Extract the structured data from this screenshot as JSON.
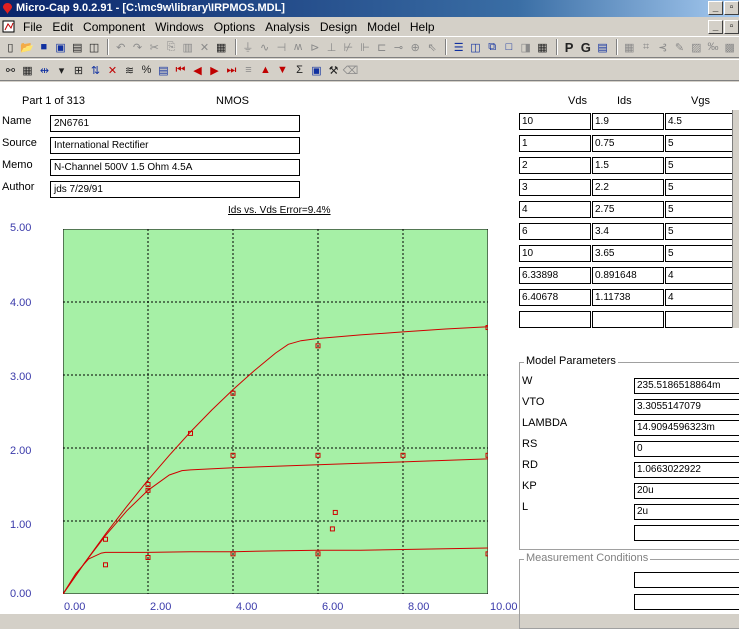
{
  "window": {
    "title": "Micro-Cap 9.0.2.91 - [C:\\mc9w\\library\\IRPMOS.MDL]"
  },
  "menu": [
    "File",
    "Edit",
    "Component",
    "Windows",
    "Options",
    "Analysis",
    "Design",
    "Model",
    "Help"
  ],
  "toolbar1": [
    {
      "name": "new-file-icon",
      "glyph": "▯",
      "tone": ""
    },
    {
      "name": "open-file-icon",
      "glyph": "📂",
      "tone": ""
    },
    {
      "name": "save-icon",
      "glyph": "■",
      "tone": "blue"
    },
    {
      "name": "save-all-icon",
      "glyph": "▣",
      "tone": "blue"
    },
    {
      "name": "print-icon",
      "glyph": "▤",
      "tone": ""
    },
    {
      "name": "print-preview-icon",
      "glyph": "◫",
      "tone": ""
    },
    {
      "sep": true
    },
    {
      "name": "undo-icon",
      "glyph": "↶",
      "tone": "gray"
    },
    {
      "name": "redo-icon",
      "glyph": "↷",
      "tone": "gray"
    },
    {
      "name": "cut-icon",
      "glyph": "✂",
      "tone": "gray"
    },
    {
      "name": "copy-icon",
      "glyph": "⎘",
      "tone": "gray"
    },
    {
      "name": "paste-icon",
      "glyph": "▥",
      "tone": "gray"
    },
    {
      "name": "delete-icon",
      "glyph": "✕",
      "tone": "gray"
    },
    {
      "name": "find-icon",
      "glyph": "▦",
      "tone": ""
    },
    {
      "sep": true
    },
    {
      "name": "ground-icon",
      "glyph": "⏚",
      "tone": "gray"
    },
    {
      "name": "resistor-icon",
      "glyph": "∿",
      "tone": "gray"
    },
    {
      "name": "capacitor-icon",
      "glyph": "⊣",
      "tone": "gray"
    },
    {
      "name": "inductor-icon",
      "glyph": "ʍ",
      "tone": "gray"
    },
    {
      "name": "diode-icon",
      "glyph": "⊳",
      "tone": "gray"
    },
    {
      "name": "battery-icon",
      "glyph": "⊥",
      "tone": "gray"
    },
    {
      "name": "npn-icon",
      "glyph": "⊬",
      "tone": "gray"
    },
    {
      "name": "pmos-icon",
      "glyph": "⊩",
      "tone": "gray"
    },
    {
      "name": "opamp-icon",
      "glyph": "⊏",
      "tone": "gray"
    },
    {
      "name": "wire-icon",
      "glyph": "⊸",
      "tone": "gray"
    },
    {
      "name": "source-icon",
      "glyph": "⊕",
      "tone": "gray"
    },
    {
      "name": "pointer-icon",
      "glyph": "⇖",
      "tone": "gray"
    },
    {
      "sep": true
    },
    {
      "name": "horizontal-layout-icon",
      "glyph": "☰",
      "tone": "blue"
    },
    {
      "name": "vertical-layout-icon",
      "glyph": "◫",
      "tone": "blue"
    },
    {
      "name": "cascade-icon",
      "glyph": "⧉",
      "tone": "blue"
    },
    {
      "name": "maximize-pane-icon",
      "glyph": "□",
      "tone": "blue"
    },
    {
      "name": "split-pane-icon",
      "glyph": "◨",
      "tone": "gray"
    },
    {
      "name": "calculator-icon",
      "glyph": "▦",
      "tone": ""
    },
    {
      "sep": true
    },
    {
      "name": "p-button-icon",
      "glyph": "P",
      "tone": "bold"
    },
    {
      "name": "g-button-icon",
      "glyph": "G",
      "tone": "bold"
    },
    {
      "name": "table-icon",
      "glyph": "▤",
      "tone": "blue"
    },
    {
      "sep": true
    },
    {
      "name": "grid-icon",
      "glyph": "▦",
      "tone": "gray"
    },
    {
      "name": "optimize-icon",
      "glyph": "⌗",
      "tone": "gray"
    },
    {
      "name": "fit-icon",
      "glyph": "⊰",
      "tone": "gray"
    },
    {
      "name": "pen-icon",
      "glyph": "✎",
      "tone": "gray"
    },
    {
      "name": "graph-icon",
      "glyph": "▨",
      "tone": "gray"
    },
    {
      "name": "units-icon",
      "glyph": "‰",
      "tone": "gray"
    },
    {
      "name": "chart-icon",
      "glyph": "▩",
      "tone": "gray"
    }
  ],
  "toolbar2": [
    {
      "name": "binoculars-icon",
      "glyph": "⚯",
      "tone": ""
    },
    {
      "name": "library-icon",
      "glyph": "▦",
      "tone": ""
    },
    {
      "name": "arrow-both-icon",
      "glyph": "⇹",
      "tone": "blue"
    },
    {
      "name": "dropdown-icon",
      "glyph": "▾",
      "tone": ""
    },
    {
      "name": "merge-icon",
      "glyph": "⊞",
      "tone": ""
    },
    {
      "name": "sort-az-icon",
      "glyph": "⇅",
      "tone": "blue"
    },
    {
      "name": "delete-part-icon",
      "glyph": "✕",
      "tone": "red"
    },
    {
      "name": "wave-icon",
      "glyph": "≋",
      "tone": ""
    },
    {
      "name": "percent-icon",
      "glyph": "%",
      "tone": ""
    },
    {
      "name": "list-icon",
      "glyph": "▤",
      "tone": "blue"
    },
    {
      "name": "first-record-icon",
      "glyph": "⏮",
      "tone": "red"
    },
    {
      "name": "previous-record-icon",
      "glyph": "◀",
      "tone": "red"
    },
    {
      "name": "next-record-icon",
      "glyph": "▶",
      "tone": "red"
    },
    {
      "name": "last-record-icon",
      "glyph": "⏭",
      "tone": "red"
    },
    {
      "name": "equal-icon",
      "glyph": "≡",
      "tone": "gray"
    },
    {
      "name": "up-icon",
      "glyph": "▲",
      "tone": "red"
    },
    {
      "name": "down-icon",
      "glyph": "▼",
      "tone": "red"
    },
    {
      "name": "sum-icon",
      "glyph": "Σ",
      "tone": ""
    },
    {
      "name": "monitor-icon",
      "glyph": "▣",
      "tone": "blue"
    },
    {
      "name": "tools-icon",
      "glyph": "⚒",
      "tone": ""
    },
    {
      "name": "eraser-icon",
      "glyph": "⌫",
      "tone": "gray"
    }
  ],
  "part": {
    "counter": "Part 1 of 313",
    "type": "NMOS"
  },
  "fields": [
    {
      "label": "Name",
      "value": "2N6761"
    },
    {
      "label": "Source",
      "value": "International Rectifier"
    },
    {
      "label": "Memo",
      "value": "N-Channel 500V 1.5 Ohm 4.5A"
    },
    {
      "label": "Author",
      "value": "jds 7/29/91"
    }
  ],
  "plot_title": "Ids vs. Vds Error=9.4%",
  "table": {
    "headers": [
      "Vds",
      "Ids",
      "Vgs"
    ],
    "rows": [
      [
        "10",
        "1.9",
        "4.5"
      ],
      [
        "1",
        "0.75",
        "5"
      ],
      [
        "2",
        "1.5",
        "5"
      ],
      [
        "3",
        "2.2",
        "5"
      ],
      [
        "4",
        "2.75",
        "5"
      ],
      [
        "6",
        "3.4",
        "5"
      ],
      [
        "10",
        "3.65",
        "5"
      ],
      [
        "6.33898",
        "0.891648",
        "4"
      ],
      [
        "6.40678",
        "1.11738",
        "4"
      ],
      [
        "",
        "",
        ""
      ]
    ]
  },
  "model_parameters": {
    "title": "Model Parameters",
    "items": [
      {
        "name": "W",
        "value": "235.5186518864m"
      },
      {
        "name": "VTO",
        "value": "3.3055147079"
      },
      {
        "name": "LAMBDA",
        "value": "14.9094596323m"
      },
      {
        "name": "RS",
        "value": "0"
      },
      {
        "name": "RD",
        "value": "1.0663022922"
      },
      {
        "name": "KP",
        "value": "20u"
      },
      {
        "name": "L",
        "value": "2u"
      },
      {
        "name": "",
        "value": ""
      }
    ]
  },
  "measurement_conditions": {
    "title": "Measurement Conditions"
  },
  "chart_data": {
    "type": "scatter",
    "title": "Ids vs. Vds Error=9.4%",
    "xlim": [
      0,
      10
    ],
    "ylim": [
      0,
      5
    ],
    "xticks": [
      "0.00",
      "2.00",
      "4.00",
      "6.00",
      "8.00",
      "10.00"
    ],
    "yticks": [
      "0.00",
      "1.00",
      "2.00",
      "3.00",
      "4.00",
      "5.00"
    ],
    "grid": true,
    "background": "#a6f0a6",
    "curve_color": "#d00000",
    "curves": [
      {
        "x": [
          0,
          0.5,
          1,
          1.5,
          2,
          2.5,
          3,
          3.5,
          4,
          4.5,
          5,
          5.3,
          5.6,
          6,
          7,
          8,
          9,
          10
        ],
        "y": [
          0,
          0.42,
          0.82,
          1.2,
          1.56,
          1.9,
          2.22,
          2.52,
          2.8,
          3.06,
          3.3,
          3.42,
          3.47,
          3.5,
          3.55,
          3.59,
          3.63,
          3.66
        ]
      },
      {
        "x": [
          0,
          0.5,
          1,
          1.5,
          2,
          2.5,
          2.8,
          3,
          4,
          5,
          6,
          7,
          8,
          9,
          10
        ],
        "y": [
          0,
          0.42,
          0.8,
          1.14,
          1.42,
          1.63,
          1.69,
          1.7,
          1.73,
          1.75,
          1.77,
          1.79,
          1.81,
          1.83,
          1.85
        ]
      },
      {
        "x": [
          0,
          0.3,
          0.6,
          0.9,
          1,
          2,
          3,
          4,
          5,
          6,
          7,
          8,
          9,
          10
        ],
        "y": [
          0,
          0.28,
          0.48,
          0.56,
          0.57,
          0.57,
          0.58,
          0.58,
          0.59,
          0.6,
          0.6,
          0.61,
          0.62,
          0.63
        ]
      }
    ],
    "points": [
      {
        "x": 1,
        "y": 0.75
      },
      {
        "x": 2,
        "y": 1.5
      },
      {
        "x": 2,
        "y": 1.42
      },
      {
        "x": 3,
        "y": 2.2
      },
      {
        "x": 4,
        "y": 2.75
      },
      {
        "x": 6,
        "y": 3.4
      },
      {
        "x": 10,
        "y": 3.65
      },
      {
        "x": 4,
        "y": 1.9
      },
      {
        "x": 6,
        "y": 1.9
      },
      {
        "x": 8,
        "y": 1.9
      },
      {
        "x": 10,
        "y": 1.9
      },
      {
        "x": 1,
        "y": 0.4
      },
      {
        "x": 2,
        "y": 0.5
      },
      {
        "x": 4,
        "y": 0.55
      },
      {
        "x": 6,
        "y": 0.55
      },
      {
        "x": 10,
        "y": 0.55
      },
      {
        "x": 6.33898,
        "y": 0.891648
      },
      {
        "x": 6.40678,
        "y": 1.11738
      }
    ]
  }
}
